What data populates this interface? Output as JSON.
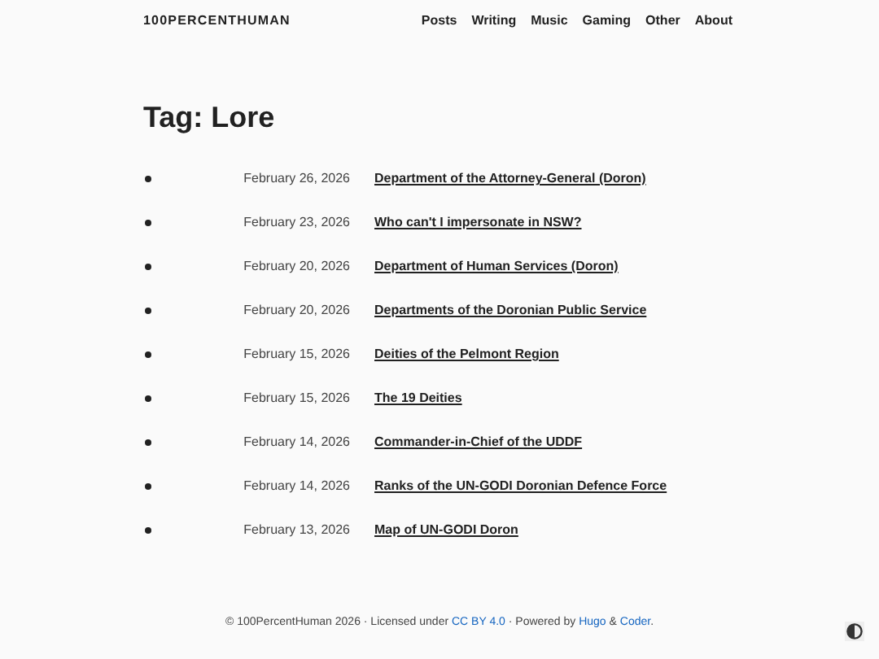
{
  "site_title": "100PERCENTHUMAN",
  "nav": [
    "Posts",
    "Writing",
    "Music",
    "Gaming",
    "Other",
    "About"
  ],
  "heading": "Tag: Lore",
  "posts": [
    {
      "date": "February 26, 2026",
      "title": "Department of the Attorney-General (Doron)"
    },
    {
      "date": "February 23, 2026",
      "title": "Who can't I impersonate in NSW?"
    },
    {
      "date": "February 20, 2026",
      "title": "Department of Human Services (Doron)"
    },
    {
      "date": "February 20, 2026",
      "title": "Departments of the Doronian Public Service"
    },
    {
      "date": "February 15, 2026",
      "title": "Deities of the Pelmont Region"
    },
    {
      "date": "February 15, 2026",
      "title": "The 19 Deities"
    },
    {
      "date": "February 14, 2026",
      "title": "Commander-in-Chief of the UDDF"
    },
    {
      "date": "February 14, 2026",
      "title": "Ranks of the UN-GODI Doronian Defence Force"
    },
    {
      "date": "February 13, 2026",
      "title": "Map of UN-GODI Doron"
    }
  ],
  "footer": [
    {
      "kind": "text",
      "text": "© 100PercentHuman 2026 · Licensed under "
    },
    {
      "kind": "link",
      "text": "CC BY 4.0"
    },
    {
      "kind": "text",
      "text": " · Powered by "
    },
    {
      "kind": "link",
      "text": "Hugo"
    },
    {
      "kind": "text",
      "text": " & "
    },
    {
      "kind": "link",
      "text": "Coder"
    },
    {
      "kind": "text",
      "text": "."
    }
  ]
}
